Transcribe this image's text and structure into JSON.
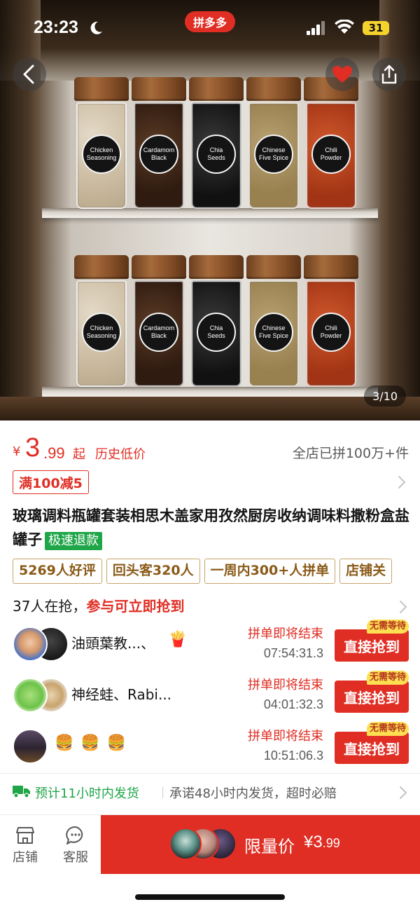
{
  "status_bar": {
    "time": "23:23",
    "app_badge": "拼多多",
    "battery": "31"
  },
  "gallery": {
    "page_indicator": "3/10",
    "jar_labels": [
      "Chicken Seasoning",
      "Cardamom Black",
      "Chia Seeds",
      "Chinese Five Spice",
      "Chili Powder"
    ]
  },
  "price": {
    "currency": "¥",
    "integer": "3",
    "decimal": ".99",
    "suffix": "起",
    "history_low": "历史低价",
    "store_sold": "全店已拼100万+件"
  },
  "coupon": "满100减5",
  "product": {
    "title": "玻璃调料瓶罐套装相思木盖家用孜然厨房收纳调味料撒粉盒盐罐子",
    "refund_tag": "极速退款"
  },
  "review_tags": [
    "5269人好评",
    "回头客320人",
    "一周内300+人拼单",
    "店铺关"
  ],
  "grab": {
    "count_text": "37人在抢，",
    "cta_text": "参与可立即抢到"
  },
  "groups": [
    {
      "name": "油頭葉教...、",
      "ending": "拼单即将结束",
      "countdown": "07:54:31.3",
      "no_wait": "无需等待",
      "button": "直接抢到"
    },
    {
      "name": "神经蛙、Rabi...",
      "ending": "拼单即将结束",
      "countdown": "04:01:32.3",
      "no_wait": "无需等待",
      "button": "直接抢到"
    },
    {
      "name": "",
      "ending": "拼单即将结束",
      "countdown": "10:51:06.3",
      "no_wait": "无需等待",
      "button": "直接抢到"
    }
  ],
  "shipping": {
    "estimate": "预计11小时内发货",
    "promise": "承诺48小时内发货，超时必赔"
  },
  "bottom_bar": {
    "store": "店铺",
    "service": "客服",
    "buy_label": "限量价",
    "buy_currency": "¥",
    "buy_int": "3",
    "buy_dec": ".99"
  },
  "colors": {
    "brand_red": "#e02e24",
    "green": "#1fa648",
    "tag_gold": "#c9a46b"
  }
}
